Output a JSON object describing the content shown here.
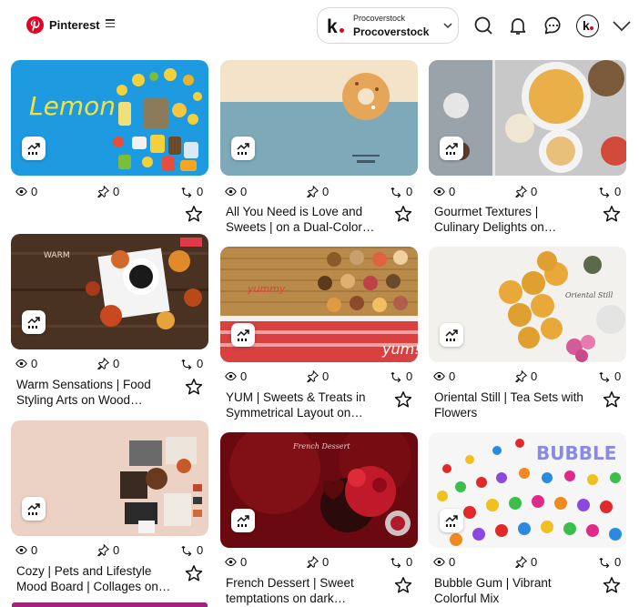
{
  "header": {
    "brand": "Pinterest",
    "account_small": "Procoverstock",
    "account_name": "Procoverstock",
    "account_logo": "k",
    "icons": [
      "search-icon",
      "bell-icon",
      "chat-icon",
      "avatar",
      "chevron-down-icon"
    ]
  },
  "colors": {
    "brand": "#e60023",
    "accent_strip": "#a3227a"
  },
  "pins": [
    {
      "views": "0",
      "pins": "0",
      "saves": "0",
      "title1": "",
      "title2": "",
      "thumb_text": "Lemon"
    },
    {
      "views": "0",
      "pins": "0",
      "saves": "0",
      "title1": "All You Need is Love and",
      "title2": "Sweets | on a Dual-Color…",
      "thumb_text": ""
    },
    {
      "views": "0",
      "pins": "0",
      "saves": "0",
      "title1": "Gourmet Textures |",
      "title2": "Culinary Delights on…",
      "thumb_text": ""
    },
    {
      "views": "0",
      "pins": "0",
      "saves": "0",
      "title1": "Warm Sensations | Food",
      "title2": "Styling Arts on Wood…",
      "thumb_text": "WARM"
    },
    {
      "views": "0",
      "pins": "0",
      "saves": "0",
      "title1": "YUM | Sweets & Treats in",
      "title2": "Symmetrical Layout on…",
      "thumb_text": "yum!"
    },
    {
      "views": "0",
      "pins": "0",
      "saves": "0",
      "title1": "Oriental Still | Tea Sets with",
      "title2": "Flowers",
      "thumb_text": ""
    },
    {
      "views": "0",
      "pins": "0",
      "saves": "0",
      "title1": "Cozy | Pets and Lifestyle",
      "title2": "Mood Board | Collages on…",
      "thumb_text": ""
    },
    {
      "views": "0",
      "pins": "0",
      "saves": "0",
      "title1": "French Dessert | Sweet",
      "title2": "temptations on dark…",
      "thumb_text": ""
    },
    {
      "views": "0",
      "pins": "0",
      "saves": "0",
      "title1": "Bubble Gum | Vibrant",
      "title2": "Colorful Mix",
      "thumb_text": "BUBBLE"
    }
  ]
}
